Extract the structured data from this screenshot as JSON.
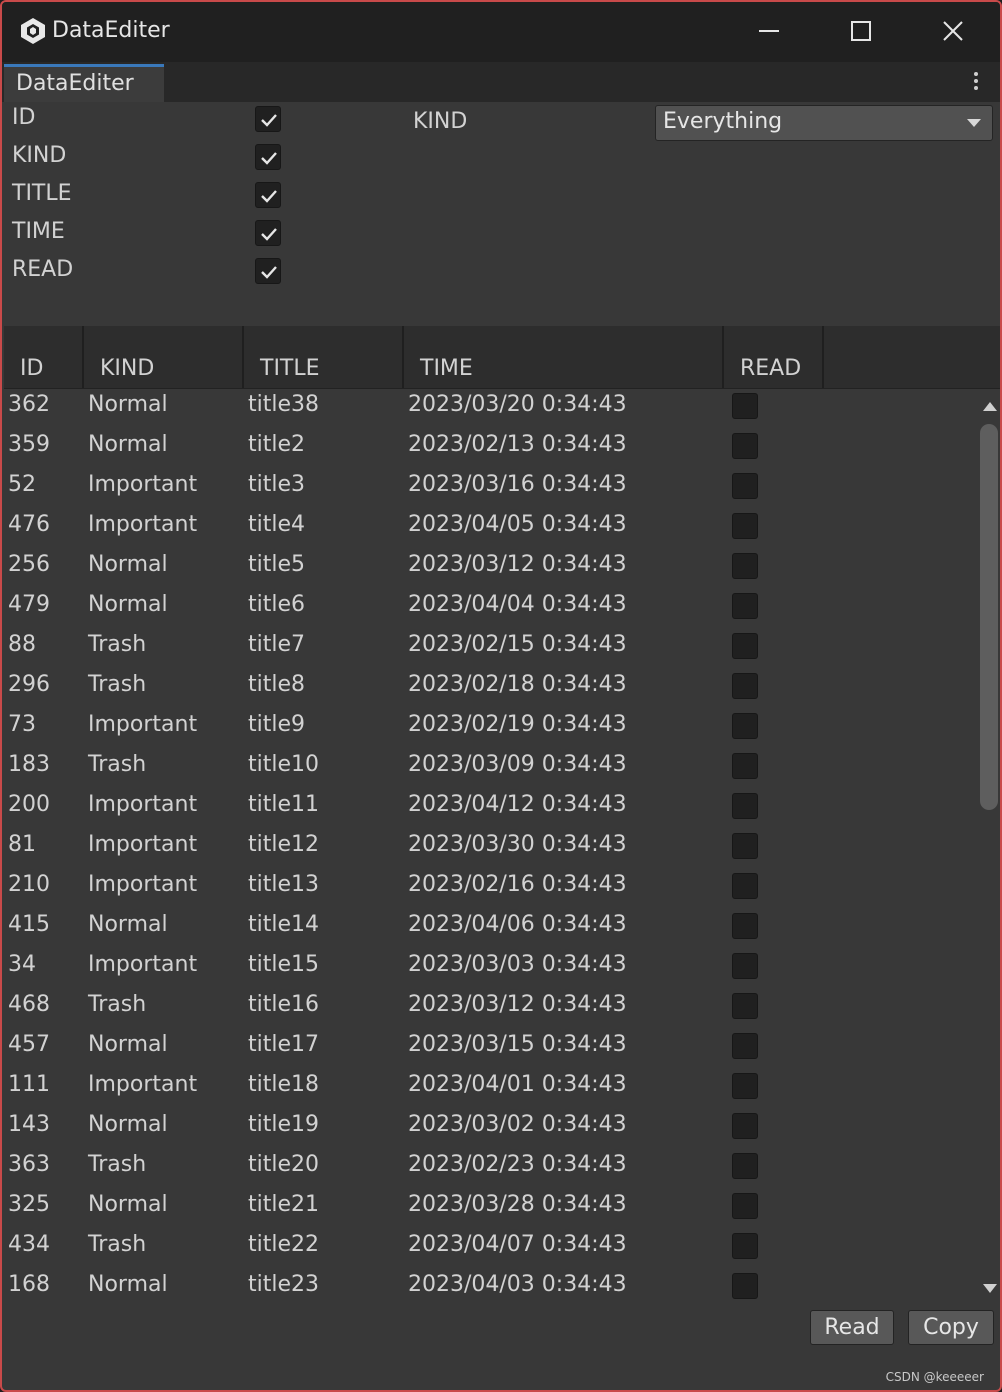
{
  "window": {
    "title": "DataEditer",
    "icon": "unity-logo-icon",
    "controls": [
      "minimize-icon",
      "maximize-icon",
      "close-icon"
    ]
  },
  "tab": {
    "label": "DataEditer",
    "menu_icon": "kebab-menu-icon"
  },
  "column_toggles": [
    {
      "label": "ID",
      "checked": true
    },
    {
      "label": "KIND",
      "checked": true
    },
    {
      "label": "TITLE",
      "checked": true
    },
    {
      "label": "TIME",
      "checked": true
    },
    {
      "label": "READ",
      "checked": true
    }
  ],
  "kind_filter": {
    "label": "KIND",
    "value": "Everything"
  },
  "table": {
    "headers": {
      "id": "ID",
      "kind": "KIND",
      "title": "TITLE",
      "time": "TIME",
      "read": "READ"
    },
    "rows": [
      {
        "id": "362",
        "kind": "Normal",
        "title": "title38",
        "time": "2023/03/20 0:34:43",
        "read": false
      },
      {
        "id": "359",
        "kind": "Normal",
        "title": "title2",
        "time": "2023/02/13 0:34:43",
        "read": false
      },
      {
        "id": "52",
        "kind": "Important",
        "title": "title3",
        "time": "2023/03/16 0:34:43",
        "read": false
      },
      {
        "id": "476",
        "kind": "Important",
        "title": "title4",
        "time": "2023/04/05 0:34:43",
        "read": false
      },
      {
        "id": "256",
        "kind": "Normal",
        "title": "title5",
        "time": "2023/03/12 0:34:43",
        "read": false
      },
      {
        "id": "479",
        "kind": "Normal",
        "title": "title6",
        "time": "2023/04/04 0:34:43",
        "read": false
      },
      {
        "id": "88",
        "kind": "Trash",
        "title": "title7",
        "time": "2023/02/15 0:34:43",
        "read": false
      },
      {
        "id": "296",
        "kind": "Trash",
        "title": "title8",
        "time": "2023/02/18 0:34:43",
        "read": false
      },
      {
        "id": "73",
        "kind": "Important",
        "title": "title9",
        "time": "2023/02/19 0:34:43",
        "read": false
      },
      {
        "id": "183",
        "kind": "Trash",
        "title": "title10",
        "time": "2023/03/09 0:34:43",
        "read": false
      },
      {
        "id": "200",
        "kind": "Important",
        "title": "title11",
        "time": "2023/04/12 0:34:43",
        "read": false
      },
      {
        "id": "81",
        "kind": "Important",
        "title": "title12",
        "time": "2023/03/30 0:34:43",
        "read": false
      },
      {
        "id": "210",
        "kind": "Important",
        "title": "title13",
        "time": "2023/02/16 0:34:43",
        "read": false
      },
      {
        "id": "415",
        "kind": "Normal",
        "title": "title14",
        "time": "2023/04/06 0:34:43",
        "read": false
      },
      {
        "id": "34",
        "kind": "Important",
        "title": "title15",
        "time": "2023/03/03 0:34:43",
        "read": false
      },
      {
        "id": "468",
        "kind": "Trash",
        "title": "title16",
        "time": "2023/03/12 0:34:43",
        "read": false
      },
      {
        "id": "457",
        "kind": "Normal",
        "title": "title17",
        "time": "2023/03/15 0:34:43",
        "read": false
      },
      {
        "id": "111",
        "kind": "Important",
        "title": "title18",
        "time": "2023/04/01 0:34:43",
        "read": false
      },
      {
        "id": "143",
        "kind": "Normal",
        "title": "title19",
        "time": "2023/03/02 0:34:43",
        "read": false
      },
      {
        "id": "363",
        "kind": "Trash",
        "title": "title20",
        "time": "2023/02/23 0:34:43",
        "read": false
      },
      {
        "id": "325",
        "kind": "Normal",
        "title": "title21",
        "time": "2023/03/28 0:34:43",
        "read": false
      },
      {
        "id": "434",
        "kind": "Trash",
        "title": "title22",
        "time": "2023/04/07 0:34:43",
        "read": false
      },
      {
        "id": "168",
        "kind": "Normal",
        "title": "title23",
        "time": "2023/04/03 0:34:43",
        "read": false
      }
    ]
  },
  "buttons": {
    "read": "Read",
    "copy": "Copy"
  },
  "watermark": "CSDN @keeeeer",
  "colors": {
    "window_border": "#c94a4a",
    "tab_accent": "#3a79bb",
    "panel": "#383838",
    "titlebar": "#202020"
  }
}
